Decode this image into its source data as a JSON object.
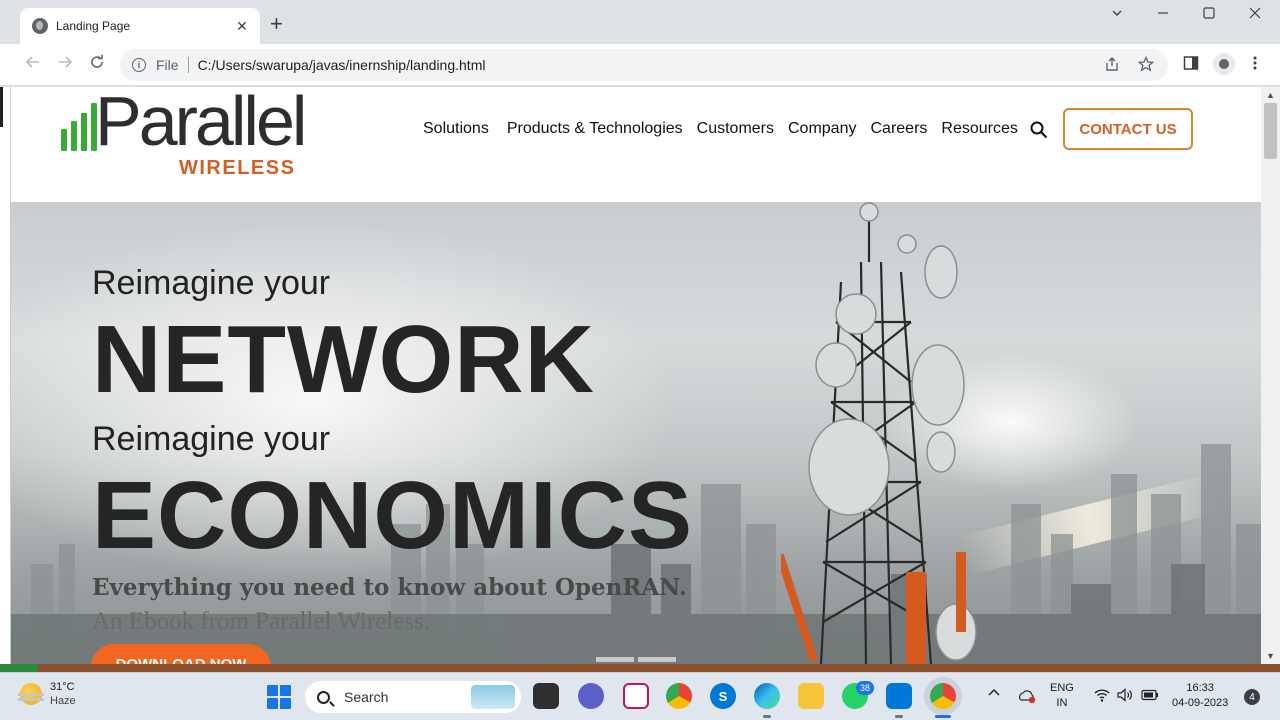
{
  "browser": {
    "tab_title": "Landing Page",
    "tab_close": "✕",
    "new_tab": "+",
    "scheme_label": "File",
    "url": "C:/Users/swarupa/javas/inernship/landing.html"
  },
  "site": {
    "logo_word": "Parallel",
    "logo_sub": "WIRELESS",
    "nav": [
      "Solutions",
      "Products & Technologies",
      "Customers",
      "Company",
      "Careers",
      "Resources"
    ],
    "contact_label": "CONTACT US"
  },
  "hero": {
    "line1": "Reimagine your",
    "big1": "NETWORK",
    "line2": "Reimagine your",
    "big2": "ECONOMICS",
    "tagline": "Everything you need to know about OpenRAN.",
    "subtag": "An Ebook from Parallel Wireless.",
    "download_label": "DOWNLOAD NOW"
  },
  "taskbar": {
    "temperature": "31°C",
    "condition": "Haze",
    "search_label": "Search",
    "whatsapp_badge": "38",
    "lang_top": "ENG",
    "lang_bottom": "IN",
    "time": "16:33",
    "date": "04-09-2023",
    "notifications": "4"
  },
  "colors": {
    "brand_orange": "#d45f24",
    "brand_green": "#3aaa35",
    "download_button": "#f26522"
  }
}
